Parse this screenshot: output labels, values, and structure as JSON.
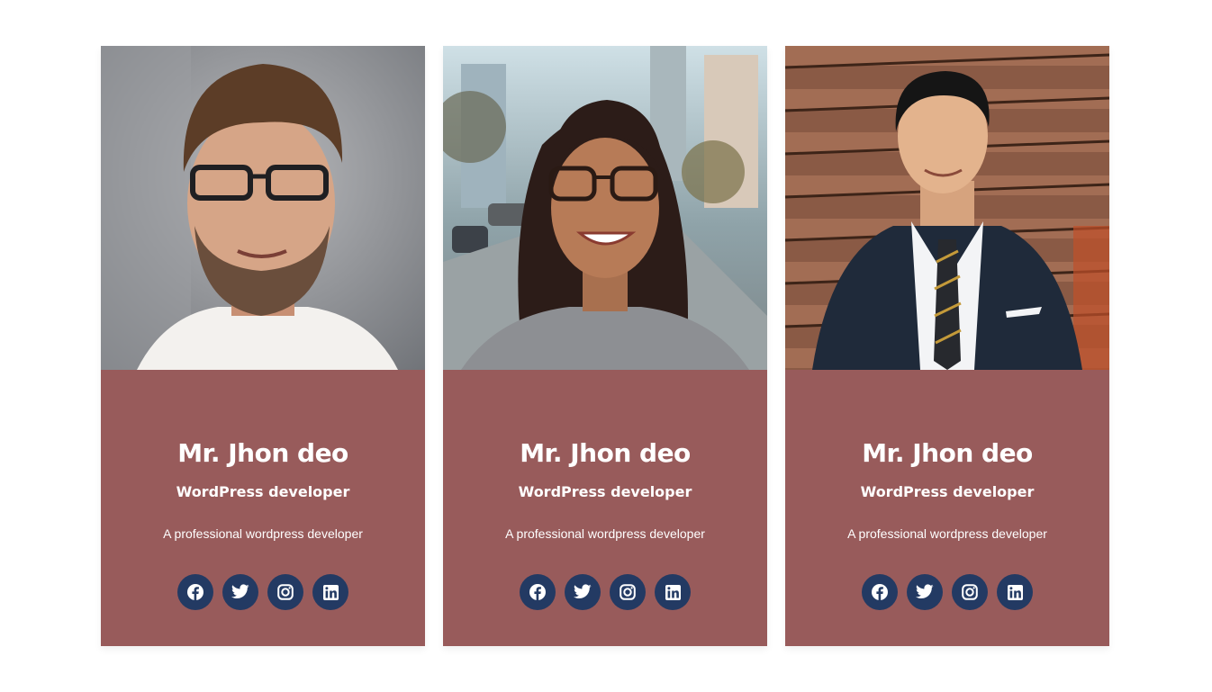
{
  "colors": {
    "card_background": "#985b5b",
    "social_button": "#233a63",
    "text": "#ffffff",
    "page_background": "#ffffff"
  },
  "team": [
    {
      "name": "Mr. Jhon deo",
      "role": "WordPress developer",
      "description": "A professional wordpress developer",
      "social": [
        "facebook-icon",
        "twitter-icon",
        "instagram-icon",
        "linkedin-icon"
      ]
    },
    {
      "name": "Mr. Jhon deo",
      "role": "WordPress developer",
      "description": "A professional wordpress developer",
      "social": [
        "facebook-icon",
        "twitter-icon",
        "instagram-icon",
        "linkedin-icon"
      ]
    },
    {
      "name": "Mr. Jhon deo",
      "role": "WordPress developer",
      "description": "A professional wordpress developer",
      "social": [
        "facebook-icon",
        "twitter-icon",
        "instagram-icon",
        "linkedin-icon"
      ]
    }
  ]
}
